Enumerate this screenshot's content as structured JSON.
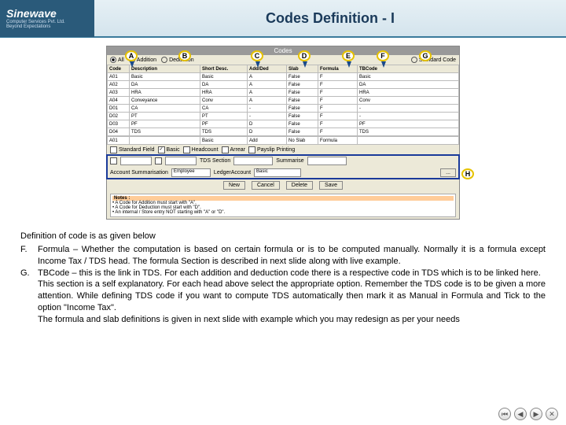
{
  "header": {
    "logo": "Sinewave",
    "logo_sub1": "Computer Services Pvt. Ltd.",
    "logo_sub2": "Beyond Expectations",
    "title": "Codes Definition - I"
  },
  "markers": {
    "A": "A",
    "B": "B",
    "C": "C",
    "D": "D",
    "E": "E",
    "F": "F",
    "G": "G",
    "H": "H"
  },
  "win": {
    "title": "Codes",
    "radios": {
      "all": "All",
      "addition": "Addition",
      "deduction": "Deduction",
      "standard": "Standard Code"
    },
    "cols": {
      "code": "Code",
      "desc": "Description",
      "short": "Short Desc.",
      "add": "Add/Ded",
      "slab": "Slab",
      "formula": "Formula",
      "tb": "TBCode"
    },
    "rows": [
      {
        "code": "A01",
        "desc": "Basic",
        "short": "Basic",
        "add": "A",
        "slab": "False",
        "formula": "F",
        "tb": "Basic"
      },
      {
        "code": "A02",
        "desc": "DA",
        "short": "DA",
        "add": "A",
        "slab": "False",
        "formula": "F",
        "tb": "DA"
      },
      {
        "code": "A03",
        "desc": "HRA",
        "short": "HRA",
        "add": "A",
        "slab": "False",
        "formula": "F",
        "tb": "HRA"
      },
      {
        "code": "A04",
        "desc": "Conveyance",
        "short": "Conv",
        "add": "A",
        "slab": "False",
        "formula": "F",
        "tb": "Conv"
      },
      {
        "code": "D01",
        "desc": "CA",
        "short": "CA",
        "add": "-",
        "slab": "False",
        "formula": "F",
        "tb": "-"
      },
      {
        "code": "D02",
        "desc": "PT",
        "short": "PT",
        "add": "-",
        "slab": "False",
        "formula": "F",
        "tb": "-"
      },
      {
        "code": "D03",
        "desc": "PF",
        "short": "PF",
        "add": "D",
        "slab": "False",
        "formula": "F",
        "tb": "PF"
      },
      {
        "code": "D04",
        "desc": "TDS",
        "short": "TDS",
        "add": "D",
        "slab": "False",
        "formula": "F",
        "tb": "TDS"
      }
    ],
    "edit": {
      "code": "A01",
      "desc_lbl": "",
      "short": "Basic",
      "add": "Add",
      "slab": "No Slab",
      "formula": "Formula",
      "tb": ""
    },
    "cbs": {
      "std": "Standard Field",
      "basic": "Basic",
      "headcount": "Headcount",
      "arrear": "Arrear",
      "pay": "Payslip Printing"
    },
    "row2": {
      "l1": "",
      "l2": "TDS Section",
      "l3": "",
      "l4": "Summarise"
    },
    "row3": {
      "acc": "Account Summarisation",
      "emp": "Employee",
      "led": "LedgerAccount",
      "val": "Basic",
      "btn": "..."
    },
    "btns": {
      "new": "New",
      "cancel": "Cancel",
      "del": "Delete",
      "save": "Save"
    },
    "notes_h": "Notes :",
    "notes": [
      "• A Code for Addition must start with \"A\".",
      "• A Code for Deduction must start with \"D\".",
      "• An internal / Store entry NOT starting with \"A\" or \"D\"."
    ]
  },
  "text": {
    "intro": "Definition of code is as given below",
    "F_label": "F.",
    "F": "Formula – Whether the computation is based on certain formula or is to be computed manually. Normally it is a formula except Income Tax / TDS head. The formula Section is described in next slide along with live example.",
    "G_label": "G.",
    "G": "TBCode – this is the link in TDS. For each addition and deduction code there is a respective code in TDS which is to be linked here.",
    "G2": "This section is a self explanatory. For each head above select the appropriate option. Remember the TDS code is to be given a more attention. While defining TDS code if you want to compute TDS automatically then mark it as Manual in Formula and Tick to the option \"Income Tax\".",
    "G3": "The formula and slab definitions is given in next slide with example which you may redesign as per your needs"
  },
  "nav": {
    "first": "⏮",
    "prev": "◀",
    "next": "▶",
    "close": "✕"
  }
}
